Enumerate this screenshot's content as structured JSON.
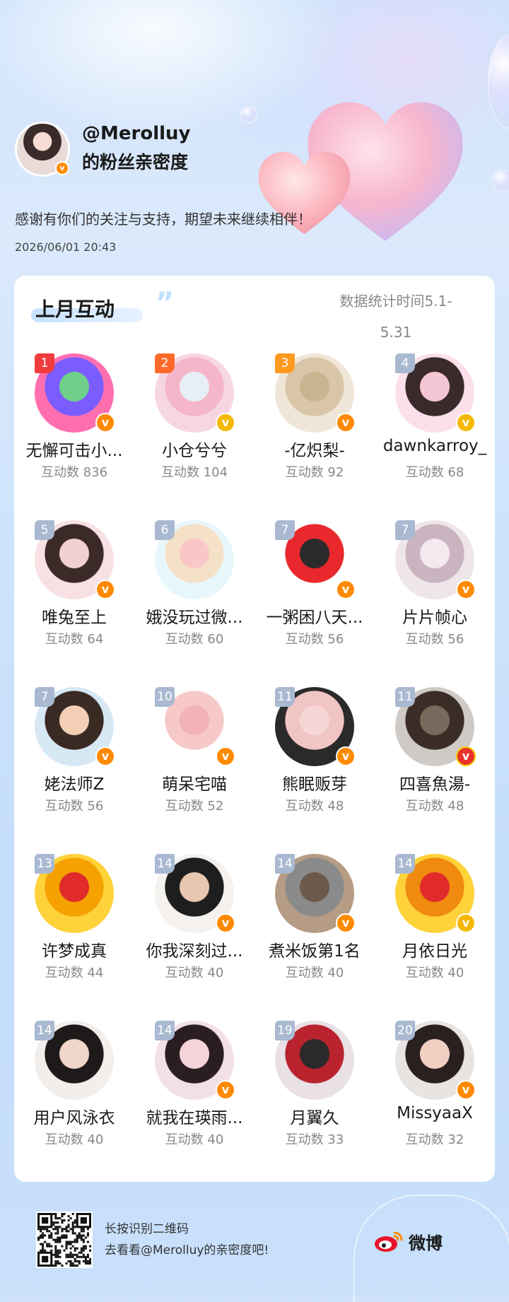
{
  "header": {
    "handle": "@Merolluy",
    "subtitle": "的粉丝亲密度",
    "thanks": "感谢有你们的关注与支持，期望未来继续相伴！",
    "datetime": "2026/06/01  20:43"
  },
  "section": {
    "title": "上月互动",
    "stats_note": "数据统计时间5.1-5.31"
  },
  "users": [
    {
      "rank": "1",
      "name": "无懈可击小...",
      "count": "互动数 836",
      "badge": "orange",
      "avatar": [
        "#ff6fb0",
        "#7a5cff",
        "#6ed08a"
      ]
    },
    {
      "rank": "2",
      "name": "小仓兮兮",
      "count": "互动数 104",
      "badge": "gold",
      "avatar": [
        "#f7d6e4",
        "#f4b6c8",
        "#e8eef8"
      ]
    },
    {
      "rank": "3",
      "name": "-亿炽梨-",
      "count": "互动数 92",
      "badge": "orange",
      "avatar": [
        "#f0e6d8",
        "#d9c6a8",
        "#c9b48f"
      ]
    },
    {
      "rank": "4",
      "name": "dawnkarroy_",
      "count": "互动数 68",
      "badge": "gold",
      "avatar": [
        "#fbe0ec",
        "#3a2a2a",
        "#f5c6d6"
      ]
    },
    {
      "rank": "5",
      "name": "唯兔至上",
      "count": "互动数 64",
      "badge": "orange",
      "avatar": [
        "#f7e1e4",
        "#3b2a28",
        "#f2d0cf"
      ]
    },
    {
      "rank": "6",
      "name": "娥没玩过微...",
      "count": "互动数 60",
      "badge": "none",
      "avatar": [
        "#e8f7fb",
        "#f5e0c8",
        "#f9c7c7"
      ]
    },
    {
      "rank": "7",
      "name": "一粥困八天...",
      "count": "互动数 56",
      "badge": "orange",
      "avatar": [
        "#ffffff",
        "#e8282d",
        "#2a2a2a"
      ]
    },
    {
      "rank": "7",
      "name": "片片帧心",
      "count": "互动数 56",
      "badge": "orange",
      "avatar": [
        "#efe6ea",
        "#c9b4bf",
        "#f3e9ee"
      ]
    },
    {
      "rank": "7",
      "name": "姥法师Z",
      "count": "互动数 56",
      "badge": "orange",
      "avatar": [
        "#d7e8f5",
        "#3a2a24",
        "#f4cfb6"
      ]
    },
    {
      "rank": "10",
      "name": "萌呆宅喵",
      "count": "互动数 52",
      "badge": "orange",
      "avatar": [
        "#ffffff",
        "#f6c8c8",
        "#f3b2b5"
      ]
    },
    {
      "rank": "11",
      "name": "熊眠贩芽",
      "count": "互动数 48",
      "badge": "orange",
      "avatar": [
        "#2a2a2a",
        "#f2c5c5",
        "#f6d6d6"
      ]
    },
    {
      "rank": "11",
      "name": "四喜魚湯-",
      "count": "互动数 48",
      "badge": "red",
      "avatar": [
        "#cfcac6",
        "#3a2c26",
        "#7a6a5e"
      ]
    },
    {
      "rank": "13",
      "name": "许梦成真",
      "count": "互动数 44",
      "badge": "none",
      "avatar": [
        "#ffd23a",
        "#f5a100",
        "#e12a2a"
      ]
    },
    {
      "rank": "14",
      "name": "你我深刻过...",
      "count": "互动数 40",
      "badge": "orange",
      "avatar": [
        "#f4f1ee",
        "#1e1e1e",
        "#e8c7b0"
      ]
    },
    {
      "rank": "14",
      "name": "煮米饭第1名",
      "count": "互动数 40",
      "badge": "orange",
      "avatar": [
        "#b69c84",
        "#8a8a8a",
        "#6b5a4b"
      ]
    },
    {
      "rank": "14",
      "name": "月依日光",
      "count": "互动数 40",
      "badge": "gold",
      "avatar": [
        "#ffd23a",
        "#f08b10",
        "#e12a2a"
      ]
    },
    {
      "rank": "14",
      "name": "用户风泳衣",
      "count": "互动数 40",
      "badge": "none",
      "avatar": [
        "#f2eeec",
        "#1e1a1a",
        "#f1d6ca"
      ]
    },
    {
      "rank": "14",
      "name": "就我在瑛雨...",
      "count": "互动数 40",
      "badge": "orange",
      "avatar": [
        "#f3e0e6",
        "#2a1e22",
        "#f4d4d8"
      ]
    },
    {
      "rank": "19",
      "name": "月翼久",
      "count": "互动数 33",
      "badge": "none",
      "avatar": [
        "#e9e1e6",
        "#b8232e",
        "#2a2a2a"
      ]
    },
    {
      "rank": "20",
      "name": "MissyaaX",
      "count": "互动数 32",
      "badge": "orange",
      "avatar": [
        "#e8e4e2",
        "#2a2020",
        "#f2cfc2"
      ]
    }
  ],
  "footer": {
    "line1": "长按识别二维码",
    "line2": "去看看@Merolluy的亲密度吧!",
    "brand": "微博"
  },
  "colors": {
    "accent_orange": "#ff8a00",
    "badge_gold": "#f5b800",
    "rank_red": "#f03c3c"
  }
}
